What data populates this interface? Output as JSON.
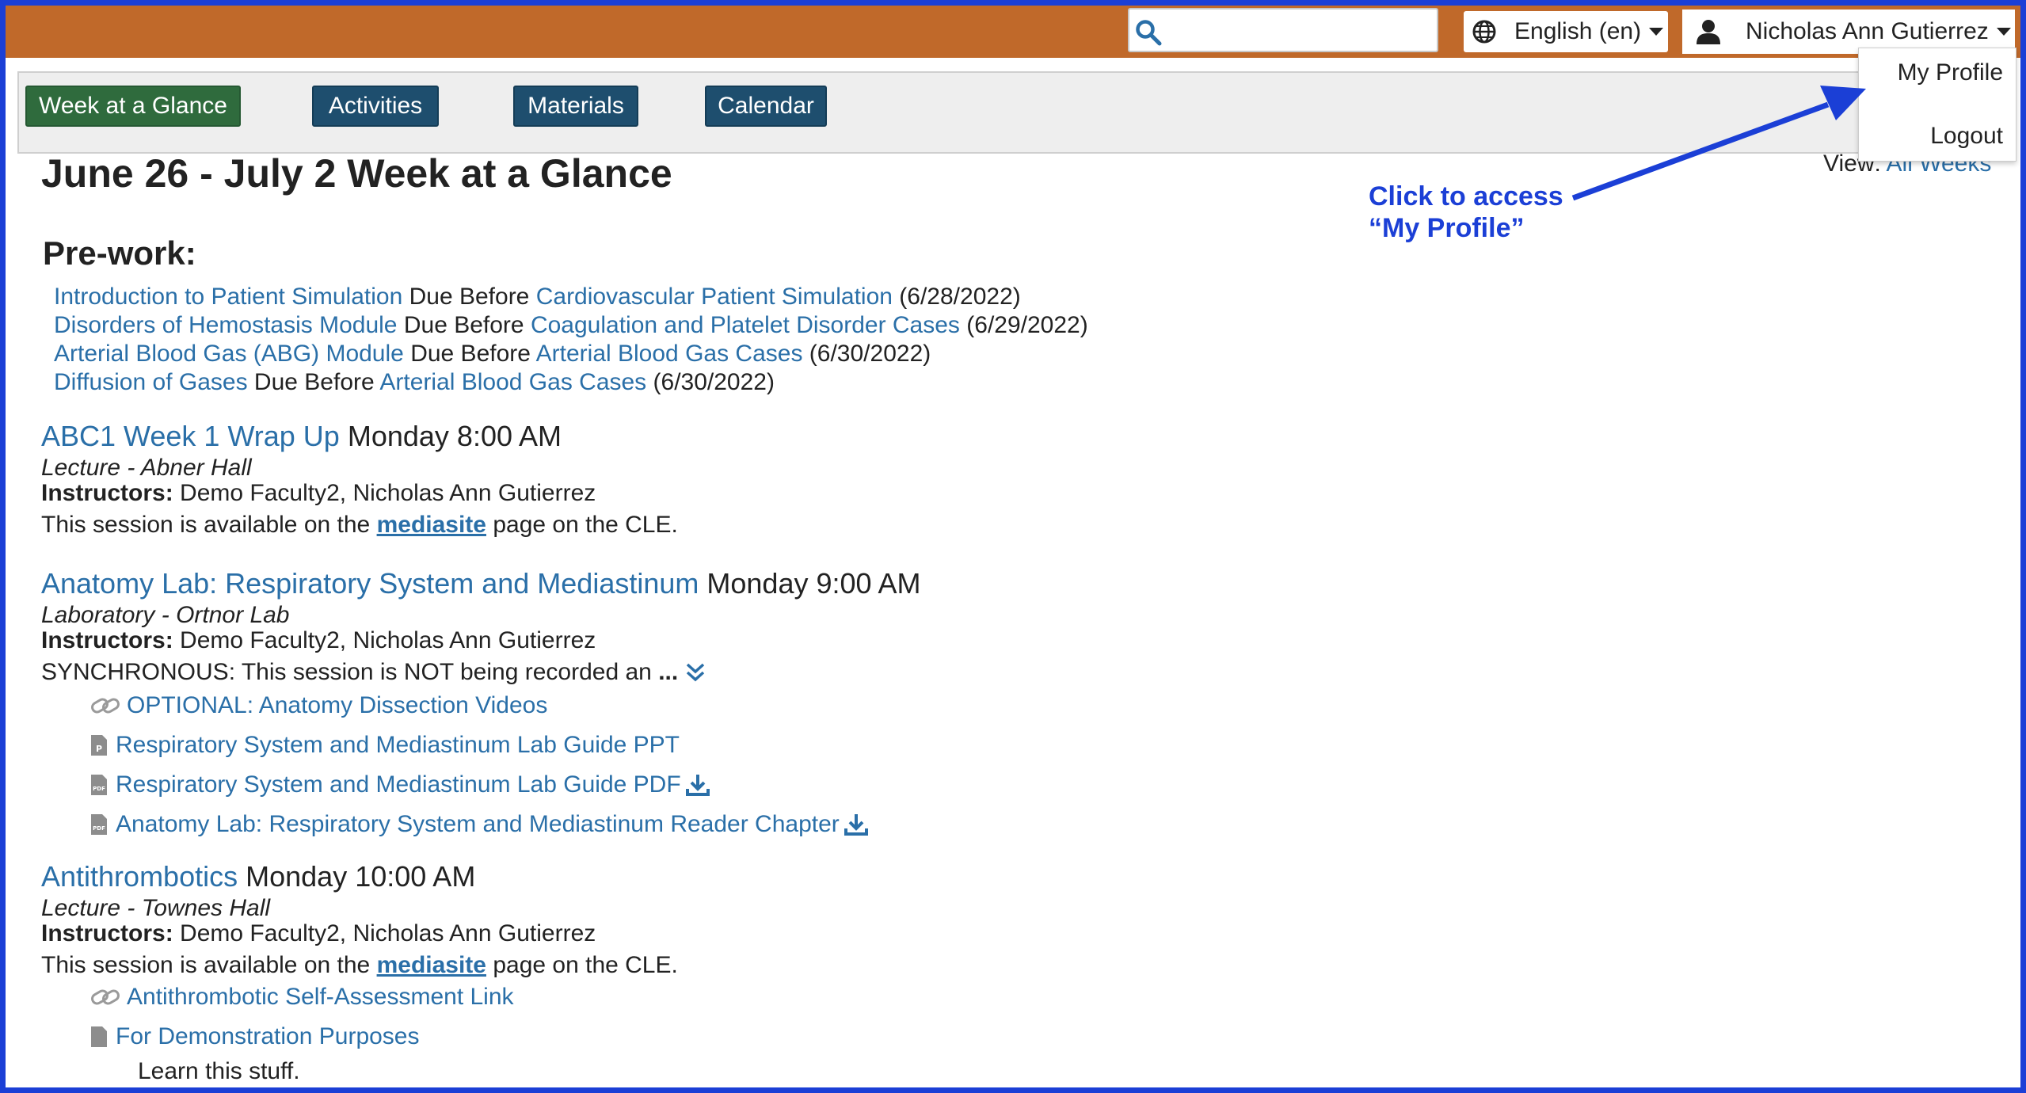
{
  "header": {
    "search_placeholder": "",
    "language": "English (en)",
    "user_name": "Nicholas Ann Gutierrez"
  },
  "dropdown": {
    "my_profile": "My Profile",
    "logout": "Logout"
  },
  "nav": {
    "tabs": [
      "Week at a Glance",
      "Activities",
      "Materials",
      "Calendar"
    ]
  },
  "view": {
    "label": "View:",
    "value": "All Weeks"
  },
  "page": {
    "title": "June 26 - July 2 Week at a Glance",
    "prework_heading": "Pre-work:"
  },
  "prework": [
    {
      "item": "Introduction to Patient Simulation",
      "due": "Due Before",
      "target": "Cardiovascular Patient Simulation",
      "date": "(6/28/2022)"
    },
    {
      "item": "Disorders of Hemostasis Module",
      "due": "Due Before",
      "target": "Coagulation and Platelet Disorder Cases",
      "date": "(6/29/2022)"
    },
    {
      "item": "Arterial Blood Gas (ABG) Module",
      "due": "Due Before",
      "target": "Arterial Blood Gas Cases",
      "date": "(6/30/2022)"
    },
    {
      "item": "Diffusion of Gases",
      "due": "Due Before",
      "target": "Arterial Blood Gas Cases",
      "date": "(6/30/2022)"
    }
  ],
  "events": [
    {
      "title": "ABC1 Week 1 Wrap Up",
      "time": "Monday 8:00 AM",
      "meta": "Lecture - Abner Hall",
      "instructors_label": "Instructors:",
      "instructors": "Demo Faculty2, Nicholas Ann Gutierrez",
      "desc_pre": "This session is available on the",
      "desc_link": "mediasite",
      "desc_post": "page on the CLE."
    },
    {
      "title": "Anatomy Lab: Respiratory System and Mediastinum",
      "time": "Monday 9:00 AM",
      "meta": "Laboratory - Ortnor Lab",
      "instructors_label": "Instructors:",
      "instructors": "Demo Faculty2, Nicholas Ann Gutierrez",
      "desc": "SYNCHRONOUS: This session is NOT being recorded an",
      "more": "...",
      "resources": [
        "OPTIONAL: Anatomy Dissection Videos",
        "Respiratory System and Mediastinum Lab Guide PPT",
        "Respiratory System and Mediastinum Lab Guide PDF",
        "Anatomy Lab: Respiratory System and Mediastinum Reader Chapter"
      ]
    },
    {
      "title": "Antithrombotics",
      "time": "Monday 10:00 AM",
      "meta": "Lecture - Townes Hall",
      "instructors_label": "Instructors:",
      "instructors": "Demo Faculty2, Nicholas Ann Gutierrez",
      "desc_pre": "This session is available on the",
      "desc_link": "mediasite",
      "desc_post": "page on the CLE.",
      "resources": [
        "Antithrombotic Self-Assessment Link",
        "For Demonstration Purposes"
      ],
      "note": "Learn this stuff."
    }
  ],
  "annotation": {
    "line1": "Click to access",
    "line2": "“My Profile”"
  },
  "colors": {
    "topbar": "#c0692a",
    "nav_button": "#1e4e6e",
    "nav_active": "#2f6b3d",
    "link": "#2a6fa8",
    "annotation": "#1b3fd6"
  }
}
